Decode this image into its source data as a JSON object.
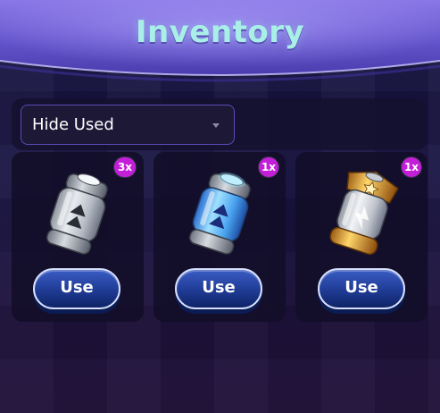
{
  "header": {
    "title": "Inventory"
  },
  "filter": {
    "selected": "Hide Used"
  },
  "items": [
    {
      "count": "3x",
      "action": "Use",
      "icon": "silver-capsule-icon"
    },
    {
      "count": "1x",
      "action": "Use",
      "icon": "blue-capsule-icon"
    },
    {
      "count": "1x",
      "action": "Use",
      "icon": "gold-capsule-icon"
    }
  ],
  "colors": {
    "title": "#a9efe8",
    "banner": "#6a5ad0",
    "badge": "#c41fd8",
    "button": "#1f3b94",
    "dropdown_border": "#5c4cb8"
  }
}
